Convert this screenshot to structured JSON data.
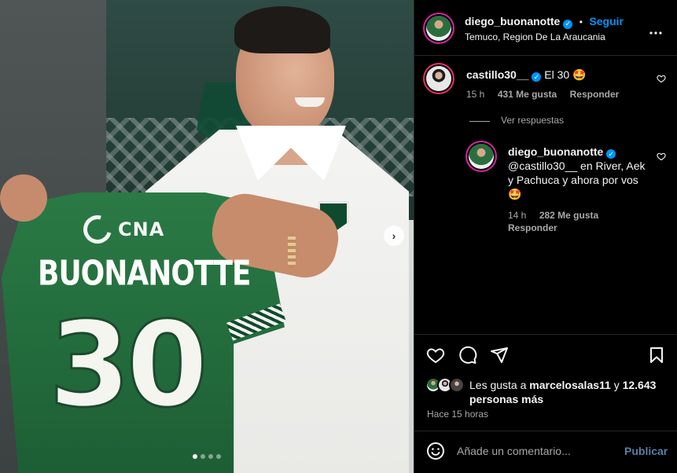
{
  "post": {
    "author": "diego_buonanotte",
    "separator": "•",
    "follow_label": "Seguir",
    "location": "Temuco, Region De La Araucania",
    "more_label": "•••"
  },
  "media": {
    "jersey_brand": "CNA",
    "jersey_name": "BUONANOTTE",
    "jersey_number": "30",
    "carousel_next": "›",
    "slides_total": 4,
    "slide_active": 1
  },
  "comments": [
    {
      "user": "castillo30__",
      "text": "El 30 🤩",
      "time": "15 h",
      "likes": "431 Me gusta",
      "reply_label": "Responder",
      "view_replies": "Ver respuestas"
    }
  ],
  "reply": {
    "user": "diego_buonanotte",
    "text": "@castillo30__ en River, Aek y Pachuca y ahora por vos 🤩",
    "time": "14 h",
    "likes": "282 Me gusta",
    "reply_label": "Responder"
  },
  "likes_summary": {
    "prefix": "Les gusta a ",
    "user": "marcelosalas11",
    "middle": " y ",
    "count": "12.643",
    "suffix": "personas más"
  },
  "timestamp": "Hace 15 horas",
  "comment_box": {
    "placeholder": "Añade un comentario...",
    "publish_label": "Publicar"
  },
  "colors": {
    "accent": "#0095f6",
    "jersey": "#2a7a45",
    "story_ring": "#d6249f"
  }
}
